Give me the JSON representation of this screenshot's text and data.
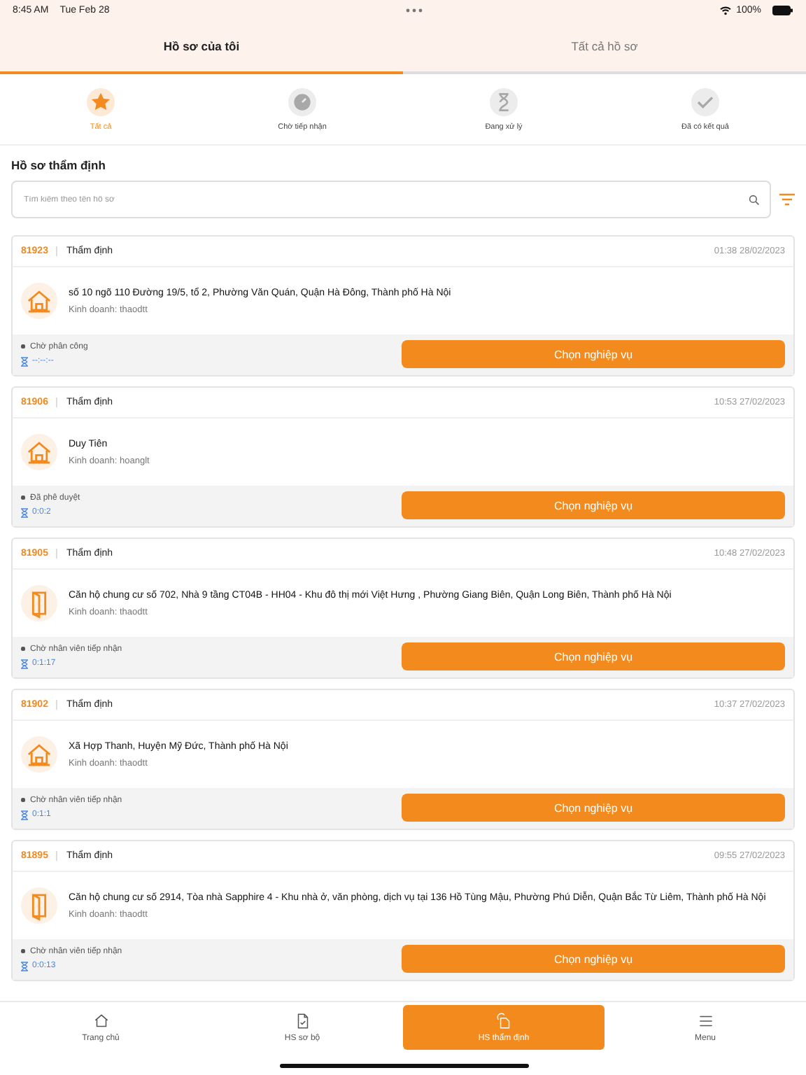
{
  "status_bar": {
    "time": "8:45 AM",
    "date": "Tue Feb 28",
    "battery": "100%"
  },
  "tabs": [
    {
      "label": "Hồ sơ của tôi",
      "selected": true
    },
    {
      "label": "Tất cả hồ sơ",
      "selected": false
    }
  ],
  "filters": [
    {
      "label": "Tất cả",
      "kind": "star",
      "selected": true
    },
    {
      "label": "Chờ tiếp nhận",
      "kind": "clock",
      "selected": false
    },
    {
      "label": "Đang xử lý",
      "kind": "hourglass",
      "selected": false
    },
    {
      "label": "Đã có kết quả",
      "kind": "check",
      "selected": false
    }
  ],
  "section_title": "Hồ sơ thẩm định",
  "search": {
    "placeholder": "Tìm kiếm theo tên hồ sơ"
  },
  "records": [
    {
      "id": "81923",
      "type": "Thẩm định",
      "time": "01:38 28/02/2023",
      "kind": "house",
      "address": "số 10 ngõ 110 Đường 19/5, tổ 2, Phường Văn Quán, Quận Hà Đông, Thành phố Hà Nội",
      "sales": "Kinh doanh: thaodtt",
      "status": "Chờ phân công",
      "timer": "--:--:--",
      "action": "Chọn nghiệp vụ"
    },
    {
      "id": "81906",
      "type": "Thẩm định",
      "time": "10:53 27/02/2023",
      "kind": "house",
      "address": "Duy Tiên",
      "sales": "Kinh doanh: hoanglt",
      "status": "Đã phê duyệt",
      "timer": "0:0:2",
      "action": "Chọn nghiệp vụ"
    },
    {
      "id": "81905",
      "type": "Thẩm định",
      "time": "10:48 27/02/2023",
      "kind": "door",
      "address": "Căn hộ chung cư số 702, Nhà 9 tầng CT04B - HH04 - Khu đô thị mới Việt Hưng , Phường Giang Biên, Quận Long Biên, Thành phố Hà Nội",
      "sales": "Kinh doanh: thaodtt",
      "status": "Chờ nhân viên tiếp nhận",
      "timer": "0:1:17",
      "action": "Chọn nghiệp vụ"
    },
    {
      "id": "81902",
      "type": "Thẩm định",
      "time": "10:37 27/02/2023",
      "kind": "house",
      "address": "Xã Hợp Thanh, Huyện Mỹ Đức, Thành phố Hà Nội",
      "sales": "Kinh doanh: thaodtt",
      "status": "Chờ nhân viên tiếp nhận",
      "timer": "0:1:1",
      "action": "Chọn nghiệp vụ"
    },
    {
      "id": "81895",
      "type": "Thẩm định",
      "time": "09:55 27/02/2023",
      "kind": "door",
      "address": "Căn hộ chung cư số 2914, Tòa nhà Sapphire 4 - Khu nhà ở, văn phòng, dịch vụ tại 136 Hồ Tùng Mậu, Phường Phú Diễn, Quận Bắc Từ Liêm, Thành phố Hà Nội",
      "sales": "Kinh doanh: thaodtt",
      "status": "Chờ nhân viên tiếp nhận",
      "timer": "0:0:13",
      "action": "Chọn nghiệp vụ"
    }
  ],
  "bottom_nav": [
    {
      "label": "Trang chủ",
      "kind": "home",
      "selected": false
    },
    {
      "label": "HS sơ bộ",
      "kind": "doc",
      "selected": false
    },
    {
      "label": "HS thẩm định",
      "kind": "appraise",
      "selected": true
    },
    {
      "label": "Menu",
      "kind": "menu",
      "selected": false
    }
  ]
}
